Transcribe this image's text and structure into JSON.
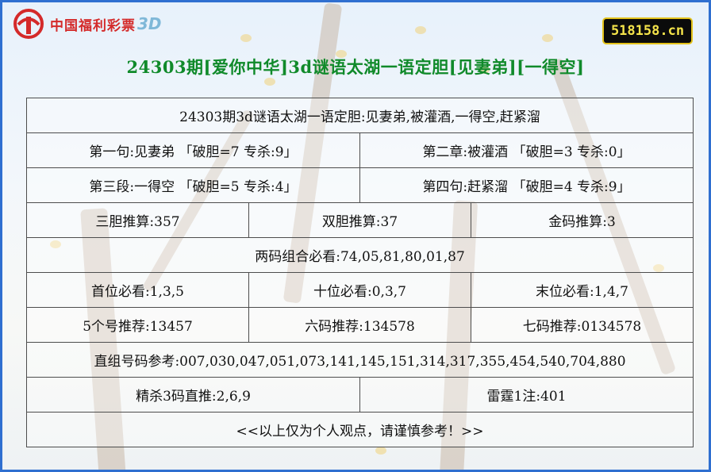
{
  "brand": {
    "logo_text": "中国福利彩票",
    "logo_suffix": "3D"
  },
  "site_badge": "518158.cn",
  "title": "24303期[爱你中华]3d谜语太湖一语定胆[见妻弟][一得空]",
  "rows": {
    "header": "24303期3d谜语太湖一语定胆:见妻弟,被灌酒,一得空,赶紧溜",
    "r1a": "第一句:见妻弟 「破胆=7 专杀:9」",
    "r1b": "第二章:被灌酒 「破胆=3 专杀:0」",
    "r2a": "第三段:一得空 「破胆=5 专杀:4」",
    "r2b": "第四句:赶紧溜 「破胆=4 专杀:9」",
    "r3a": "三胆推算:357",
    "r3b": "双胆推算:37",
    "r3c": "金码推算:3",
    "r4": "两码组合必看:74,05,81,80,01,87",
    "r5a": "首位必看:1,3,5",
    "r5b": "十位必看:0,3,7",
    "r5c": "末位必看:1,4,7",
    "r6a": "5个号推荐:13457",
    "r6b": "六码推荐:134578",
    "r6c": "七码推荐:0134578",
    "r7": "直组号码参考:007,030,047,051,073,141,145,151,314,317,355,454,540,704,880",
    "r8a": "精杀3码直推:2,6,9",
    "r8b": "雷霆1注:401",
    "r9": "<<以上仅为个人观点，请谨慎参考！>>"
  },
  "colors": {
    "title": "#108a2a",
    "border": "#2f6fd0",
    "badge_text": "#f4e34a",
    "badge_border": "#e3c21a"
  }
}
